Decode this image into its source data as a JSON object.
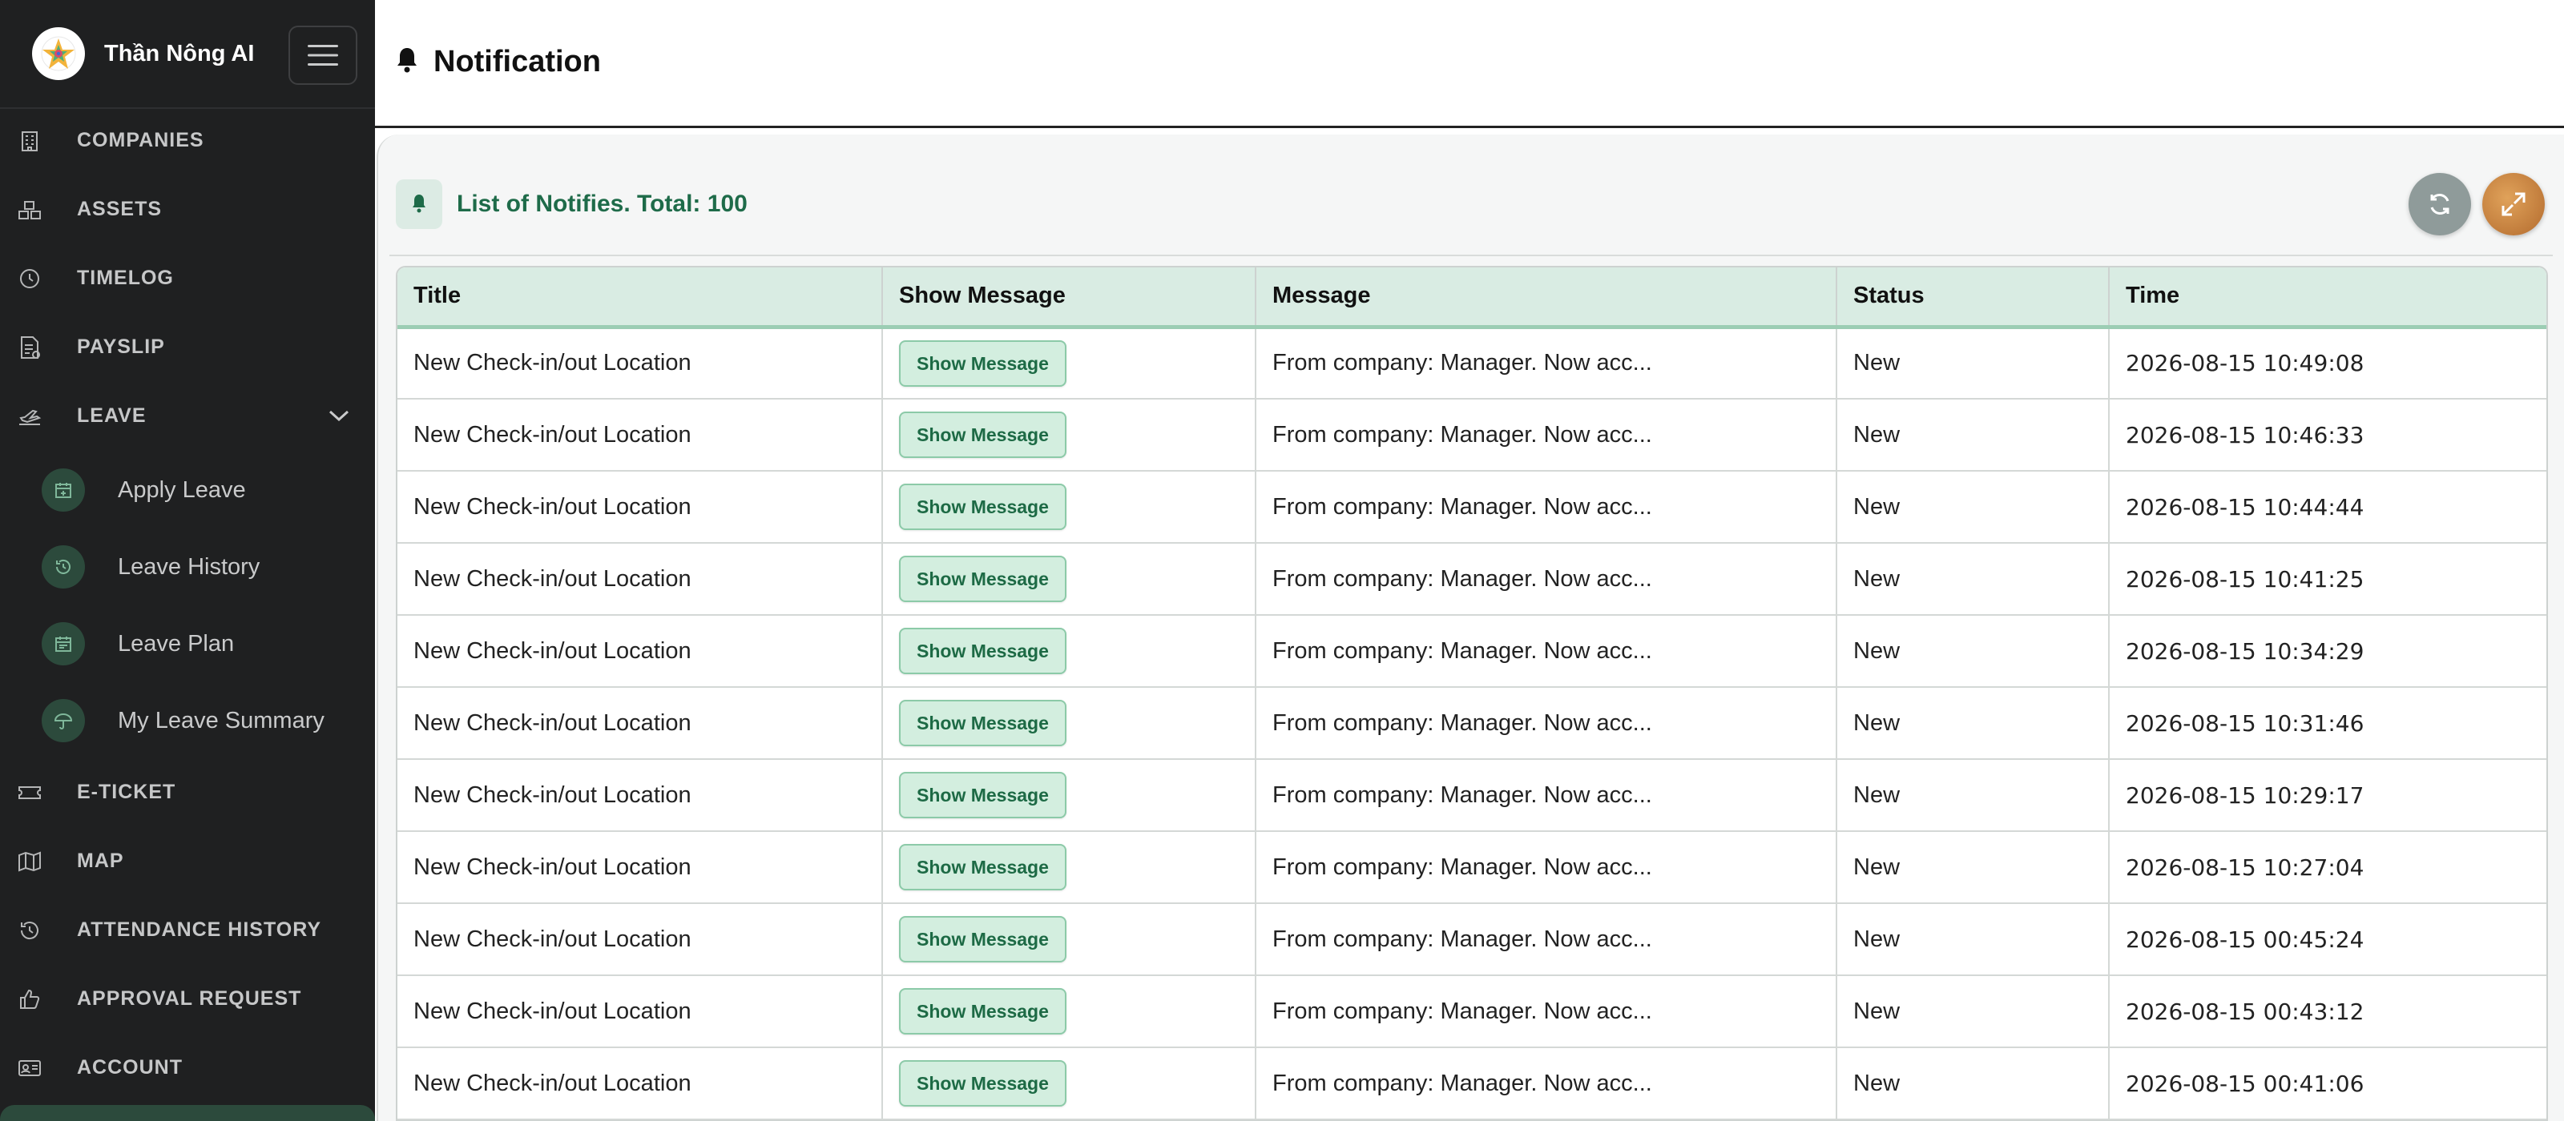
{
  "brand": {
    "name": "Thần Nông AI"
  },
  "sidebar": {
    "items": [
      {
        "label": "COMPANIES",
        "icon": "building-icon"
      },
      {
        "label": "ASSETS",
        "icon": "assets-icon"
      },
      {
        "label": "TIMELOG",
        "icon": "clock-icon"
      },
      {
        "label": "PAYSLIP",
        "icon": "payslip-icon"
      },
      {
        "label": "LEAVE",
        "icon": "plane-icon",
        "expanded": true
      },
      {
        "label": "E-TICKET",
        "icon": "ticket-icon"
      },
      {
        "label": "MAP",
        "icon": "map-icon"
      },
      {
        "label": "ATTENDANCE HISTORY",
        "icon": "history-icon"
      },
      {
        "label": "APPROVAL REQUEST",
        "icon": "thumbs-up-icon"
      },
      {
        "label": "ACCOUNT",
        "icon": "id-card-icon"
      }
    ],
    "leave_sub": [
      {
        "label": "Apply Leave",
        "icon": "calendar-plus-icon"
      },
      {
        "label": "Leave History",
        "icon": "history-icon"
      },
      {
        "label": "Leave Plan",
        "icon": "calendar-icon"
      },
      {
        "label": "My Leave Summary",
        "icon": "umbrella-icon"
      }
    ]
  },
  "header": {
    "title": "Notification"
  },
  "list": {
    "title": "List of Notifies. Total: 100"
  },
  "colors": {
    "accent": "#1e6b49",
    "sidebar_bg": "#1f2021",
    "header_row": "#d9ece3"
  },
  "table": {
    "columns": [
      "Title",
      "Show Message",
      "Message",
      "Status",
      "Time"
    ],
    "button_label": "Show Message",
    "rows": [
      {
        "title": "New Check-in/out Location",
        "message": "From company: Manager. Now acc...",
        "status": "New",
        "time": "2026-08-15 10:49:08"
      },
      {
        "title": "New Check-in/out Location",
        "message": "From company: Manager. Now acc...",
        "status": "New",
        "time": "2026-08-15 10:46:33"
      },
      {
        "title": "New Check-in/out Location",
        "message": "From company: Manager. Now acc...",
        "status": "New",
        "time": "2026-08-15 10:44:44"
      },
      {
        "title": "New Check-in/out Location",
        "message": "From company: Manager. Now acc...",
        "status": "New",
        "time": "2026-08-15 10:41:25"
      },
      {
        "title": "New Check-in/out Location",
        "message": "From company: Manager. Now acc...",
        "status": "New",
        "time": "2026-08-15 10:34:29"
      },
      {
        "title": "New Check-in/out Location",
        "message": "From company: Manager. Now acc...",
        "status": "New",
        "time": "2026-08-15 10:31:46"
      },
      {
        "title": "New Check-in/out Location",
        "message": "From company: Manager. Now acc...",
        "status": "New",
        "time": "2026-08-15 10:29:17"
      },
      {
        "title": "New Check-in/out Location",
        "message": "From company: Manager. Now acc...",
        "status": "New",
        "time": "2026-08-15 10:27:04"
      },
      {
        "title": "New Check-in/out Location",
        "message": "From company: Manager. Now acc...",
        "status": "New",
        "time": "2026-08-15 00:45:24"
      },
      {
        "title": "New Check-in/out Location",
        "message": "From company: Manager. Now acc...",
        "status": "New",
        "time": "2026-08-15 00:43:12"
      },
      {
        "title": "New Check-in/out Location",
        "message": "From company: Manager. Now acc...",
        "status": "New",
        "time": "2026-08-15 00:41:06"
      }
    ]
  }
}
